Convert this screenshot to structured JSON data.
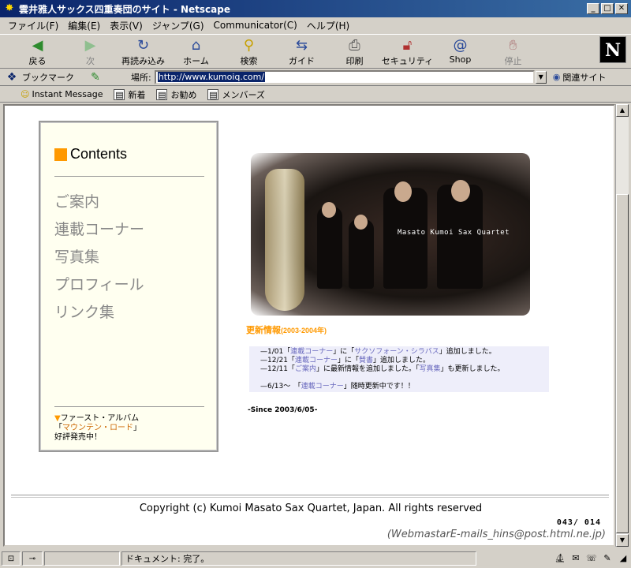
{
  "window": {
    "title": "雲井雅人サックス四重奏団のサイト - Netscape",
    "icon": "netscape-app-icon"
  },
  "menubar": [
    "ファイル(F)",
    "編集(E)",
    "表示(V)",
    "ジャンプ(G)",
    "Communicator(C)",
    "ヘルプ(H)"
  ],
  "toolbar": {
    "back": "戻る",
    "forward": "次",
    "reload": "再読み込み",
    "home": "ホーム",
    "search": "検索",
    "guide": "ガイド",
    "print": "印刷",
    "security": "セキュリティ",
    "shop": "Shop",
    "stop": "停止"
  },
  "location": {
    "bookmarks": "ブックマーク",
    "label": "場所:",
    "url": "http://www.kumoiq.com/",
    "related": "関連サイト"
  },
  "personal_toolbar": [
    "Instant Message",
    "新着",
    "お勧め",
    "メンバーズ"
  ],
  "page": {
    "contents_heading": "Contents",
    "nav": [
      "ご案内",
      "連載コーナー",
      "写真集",
      "プロフィール",
      "リンク集"
    ],
    "album": {
      "line1": "ファースト・アルバム",
      "open": "「",
      "title": "マウンテン・ロード",
      "close": "」",
      "line3": "好評発売中！"
    },
    "photo_caption": "Masato Kumoi Sax Quartet",
    "news": {
      "title": "更新情報",
      "period": "(2003-2004年)",
      "items": [
        {
          "prefix": "—1/01「",
          "link": "連載コーナー",
          "mid": "」に「",
          "link2": "サクソフォーン・シラバス",
          "suffix": "」追加しました。"
        },
        {
          "prefix": "—12/21「",
          "link": "連載コーナー",
          "mid": "」に「",
          "link2": "賛書",
          "suffix": "」追加しました。"
        },
        {
          "prefix": "—12/11「",
          "link": "ご案内",
          "mid": "」に最新情報を追加しました。「",
          "link2": "写真集",
          "suffix": "」も更新しました。"
        },
        {
          "prefix": "—6/13〜　「",
          "link": "連載コーナー",
          "mid": "」随時更新中です！！",
          "link2": "",
          "suffix": ""
        }
      ],
      "since": "-Since 2003/6/05-"
    },
    "copyright": "Copyright (c) Kumoi Masato Sax Quartet, Japan. All rights reserved",
    "counter": "043/ 014",
    "webmaster": "(WebmastarE-mails_hins@post.html.ne.jp)"
  },
  "status": {
    "text": "ドキュメント: 完了。"
  }
}
